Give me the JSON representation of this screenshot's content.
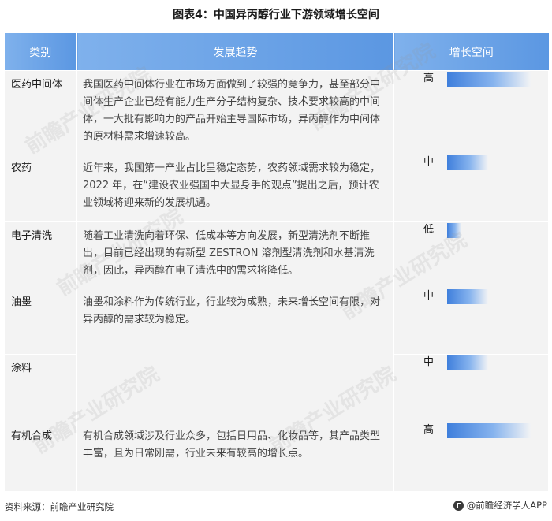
{
  "title": "图表4：中国异丙醇行业下游领域增长空间",
  "table": {
    "headers": [
      "类别",
      "发展趋势",
      "增长空间"
    ],
    "rows": [
      {
        "category": "医药中间体",
        "trend": "我国医药中间体行业在市场方面做到了较强的竞争力，甚至部分中间体生产企业已经有能力生产分子结构复杂、技术要求较高的中间体，一大批有影响力的产品开始主导国际市场，异丙醇作为中间体的原材料需求增速较高。",
        "growth": "高",
        "growth_fraction": 1.0
      },
      {
        "category": "农药",
        "trend": "近年来，我国第一产业占比呈稳定态势，农药领域需求较为稳定，2022 年，在“建设农业强国中大显身手的观点”提出之后，预计农业领域将迎来新的发展机遇。",
        "growth": "中",
        "growth_fraction": 0.49
      },
      {
        "category": "电子清洗",
        "trend": "随着工业清洗向着环保、低成本等方向发展，新型清洗剂不断推出，目前已经出现的有新型 ZESTRON 溶剂型清洗剂和水基清洗剂，因此，异丙醇在电子清洗中的需求将降低。",
        "growth": "低",
        "growth_fraction": 0.17
      },
      {
        "category": "油墨",
        "trend": "油墨和涂料作为传统行业，行业较为成熟，未来增长空间有限，对异丙醇的需求较为稳定。",
        "growth": "中",
        "growth_fraction": 0.49
      },
      {
        "category": "涂料",
        "trend": "",
        "growth": "中",
        "growth_fraction": 0.49
      },
      {
        "category": "有机合成",
        "trend": "有机合成领域涉及行业众多，包括日用品、化妆品等，其产品类型丰富，且为日常刚需，行业未来有较高的增长点。",
        "growth": "高",
        "growth_fraction": 1.0
      }
    ]
  },
  "footer": {
    "source": "资料来源：前瞻产业研究院",
    "brand": "@前瞻经济学人APP"
  },
  "watermark": "前瞻产业研究院",
  "colors": {
    "header": "#5b97e2",
    "bar": "#3f7fdc",
    "cell_bg": "#f3f3f3"
  }
}
